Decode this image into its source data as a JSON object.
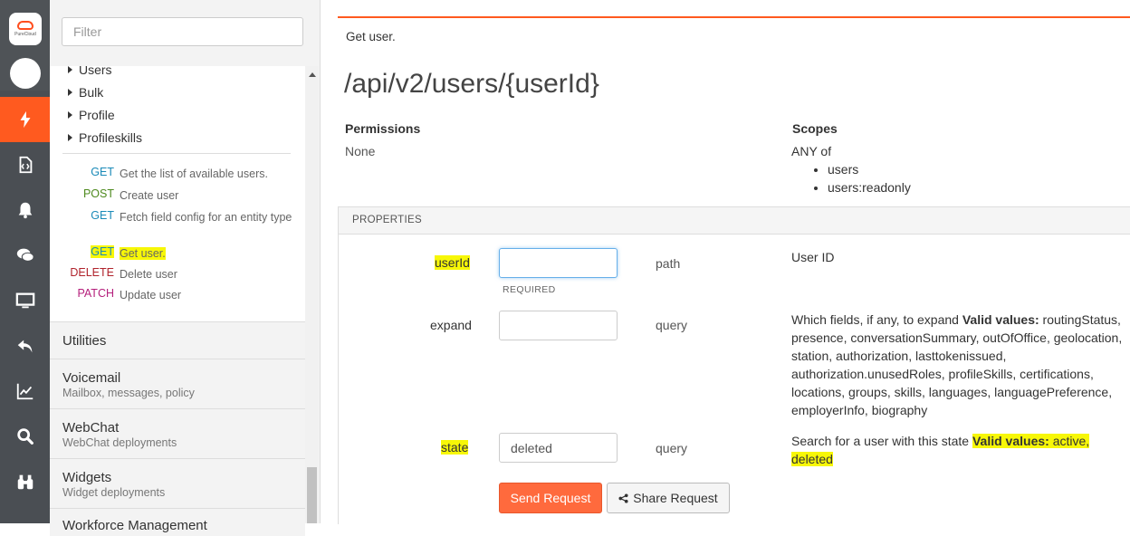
{
  "rail": {
    "logo_text": "PureCloud",
    "items": [
      {
        "icon": "lightning-icon",
        "active": true
      },
      {
        "icon": "code-file-icon"
      },
      {
        "icon": "bell-icon"
      },
      {
        "icon": "chat-icon"
      },
      {
        "icon": "monitor-icon"
      },
      {
        "icon": "reply-icon"
      },
      {
        "icon": "chart-icon"
      },
      {
        "icon": "search-icon"
      },
      {
        "icon": "binoculars-icon"
      }
    ],
    "colors": {
      "rail": "#4a4e53",
      "active": "#ff5a1f"
    }
  },
  "nav": {
    "filter_placeholder": "Filter",
    "folders": [
      "Users",
      "Bulk",
      "Profile",
      "Profileskills"
    ],
    "operations": [
      {
        "verb": "GET",
        "desc": "Get the list of available users."
      },
      {
        "verb": "POST",
        "desc": "Create user"
      },
      {
        "verb": "GET",
        "desc": "Fetch field config for an entity type"
      },
      {
        "verb": "GET",
        "desc": "Get user."
      },
      {
        "verb": "DELETE",
        "desc": "Delete user"
      },
      {
        "verb": "PATCH",
        "desc": "Update user"
      }
    ],
    "sections": [
      {
        "title": "Utilities",
        "subtitle": ""
      },
      {
        "title": "Voicemail",
        "subtitle": "Mailbox, messages, policy"
      },
      {
        "title": "WebChat",
        "subtitle": "WebChat deployments"
      },
      {
        "title": "Widgets",
        "subtitle": "Widget deployments"
      },
      {
        "title": "Workforce Management",
        "subtitle": ""
      }
    ]
  },
  "main": {
    "summary": "Get user.",
    "path": "/api/v2/users/{userId}",
    "permissions_label": "Permissions",
    "permissions_value": "None",
    "scopes_label": "Scopes",
    "scopes_any": "ANY of",
    "scopes": [
      "users",
      "users:readonly"
    ],
    "properties_label": "PROPERTIES",
    "params": {
      "userId": {
        "name": "userId",
        "value": "",
        "required": "REQUIRED",
        "type": "path",
        "desc": "User ID"
      },
      "expand": {
        "name": "expand",
        "value": "",
        "type": "query",
        "desc_prefix": "Which fields, if any, to expand ",
        "valid_label": "Valid values:",
        "desc_values": " routingStatus, presence, conversationSummary, outOfOffice, geolocation, station, authorization, lasttokenissued, authorization.unusedRoles, profileSkills, certifications, locations, groups, skills, languages, languagePreference, employerInfo, biography"
      },
      "state": {
        "name": "state",
        "value": "deleted",
        "type": "query",
        "desc_prefix": "Search for a user with this state ",
        "valid_label": "Valid values:",
        "desc_values_1": " active, ",
        "desc_values_2": "deleted"
      }
    },
    "send_button": "Send Request",
    "share_button": "Share Request",
    "accent": "#ff5a1f",
    "highlight": "#f7f707"
  }
}
